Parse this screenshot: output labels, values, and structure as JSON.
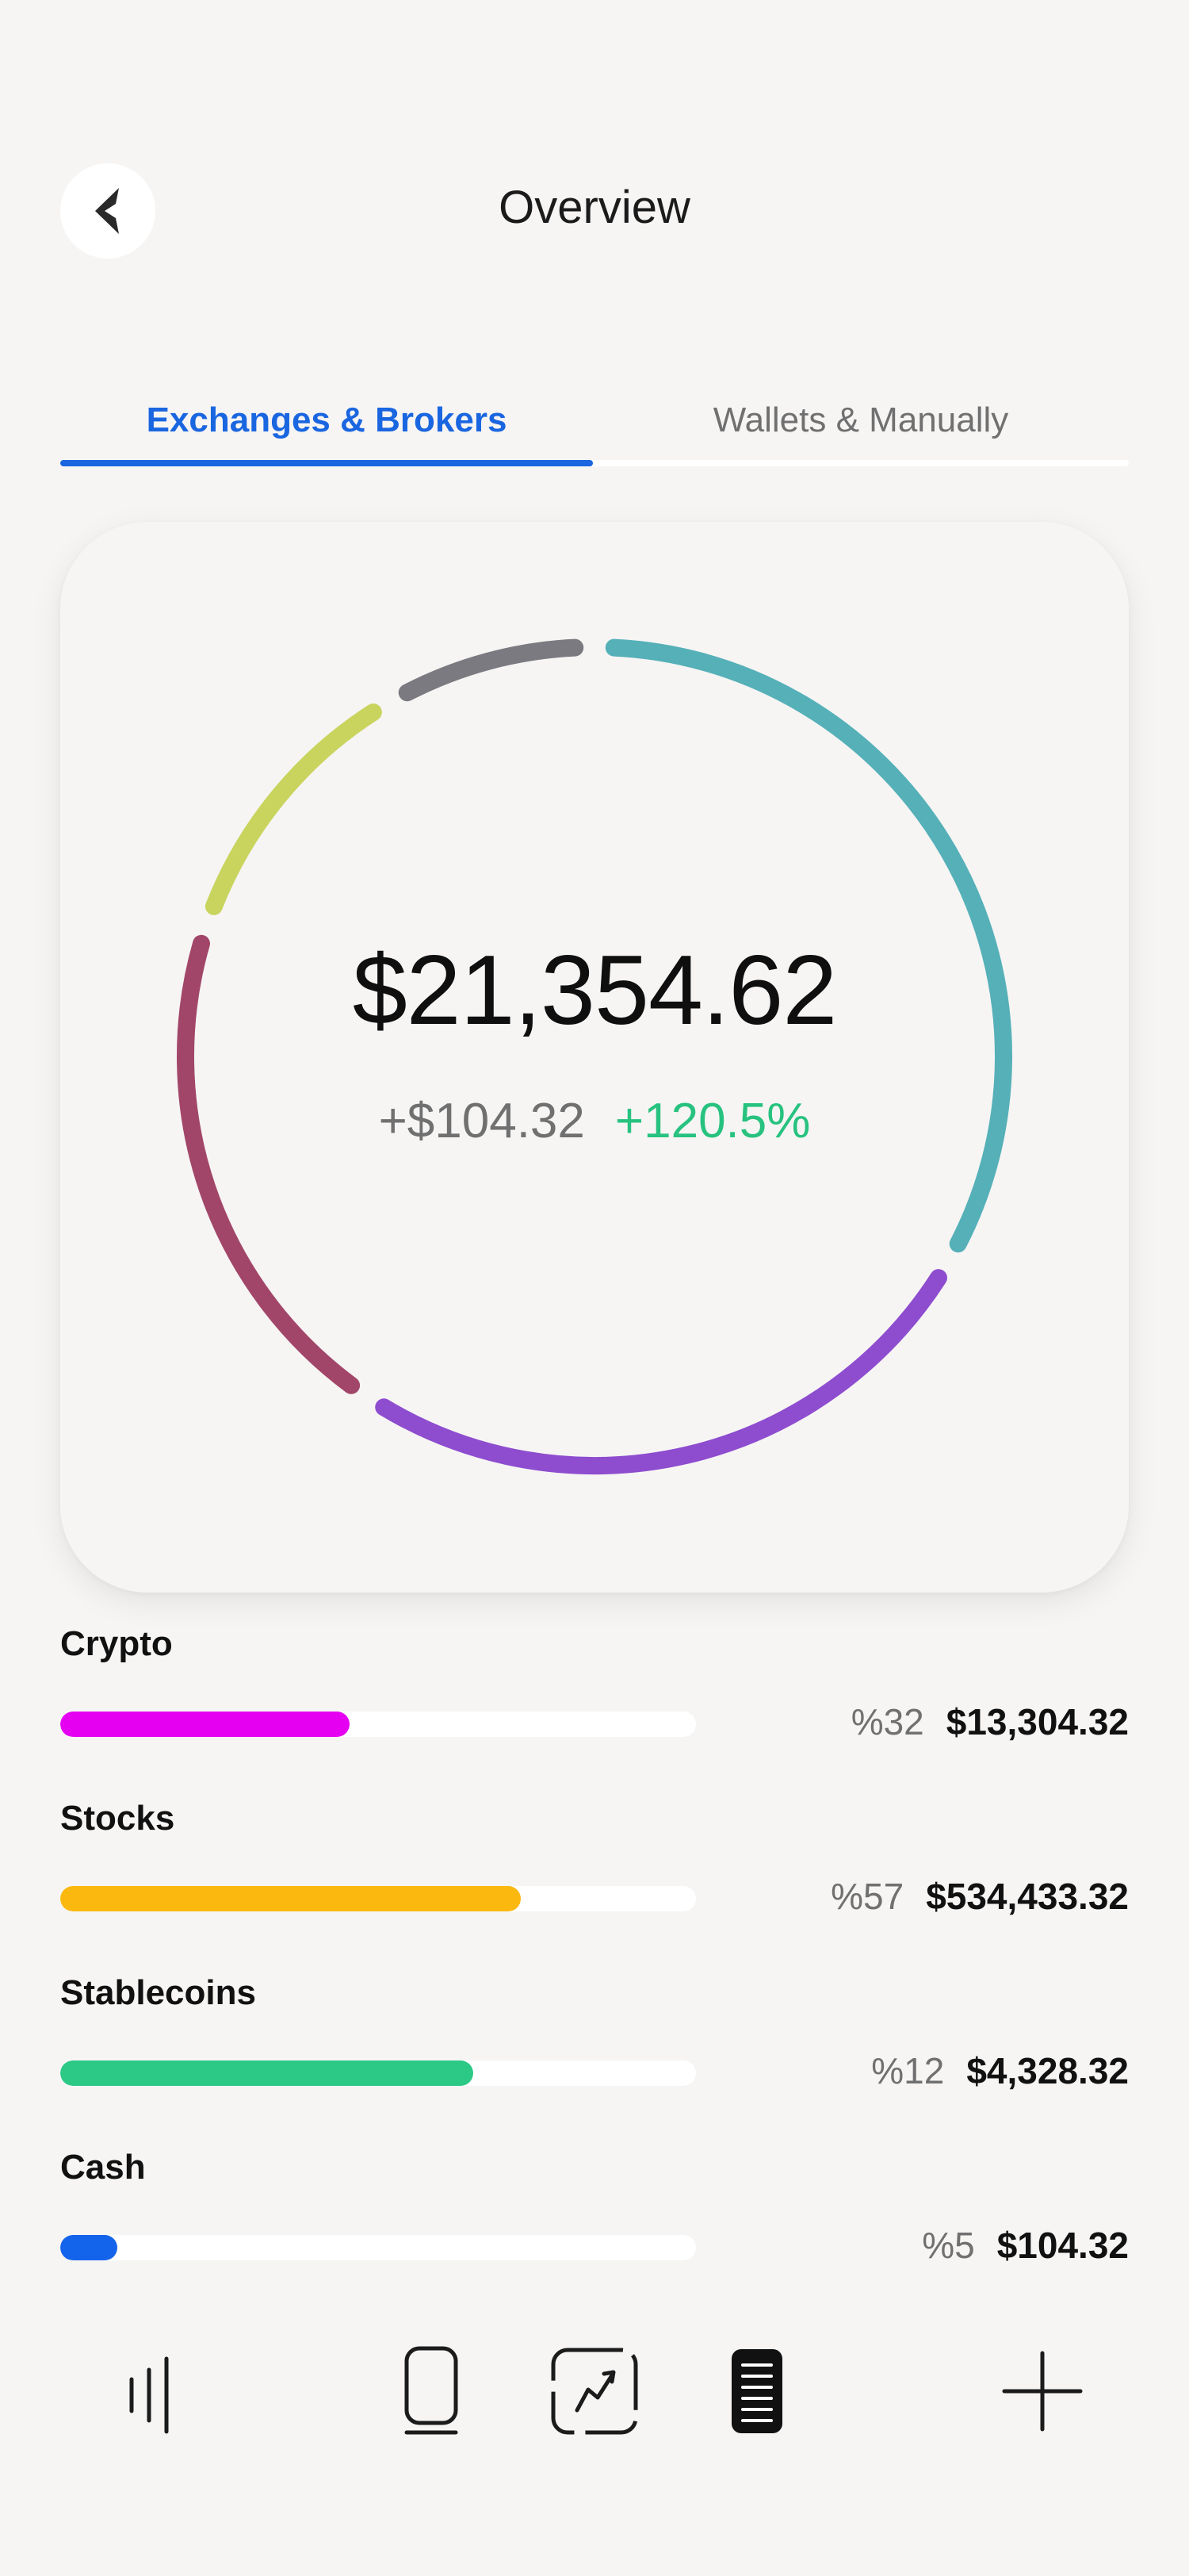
{
  "header": {
    "title": "Overview"
  },
  "tabs": [
    {
      "label": "Exchanges & Brokers",
      "active": true
    },
    {
      "label": "Wallets & Manually",
      "active": false
    }
  ],
  "summary": {
    "total": "$21,354.62",
    "change_abs": "+$104.32",
    "change_pct": "+120.5%"
  },
  "chart_data": {
    "type": "pie",
    "style": "donut-ring",
    "segments": [
      {
        "value": 32,
        "color": "#55b0b8"
      },
      {
        "value": 25,
        "color": "#8e4ccf"
      },
      {
        "value": 20,
        "color": "#a24669"
      },
      {
        "value": 11,
        "color": "#c9d45e"
      },
      {
        "value": 8,
        "color": "#7a7a80"
      }
    ]
  },
  "assets": [
    {
      "name": "Crypto",
      "percent": "%32",
      "amount": "$13,304.32",
      "fill": 0.455,
      "color": "#e500f2"
    },
    {
      "name": "Stocks",
      "percent": "%57",
      "amount": "$534,433.32",
      "fill": 0.725,
      "color": "#fbb80f"
    },
    {
      "name": "Stablecoins",
      "percent": "%12",
      "amount": "$4,328.32",
      "fill": 0.65,
      "color": "#2bc985"
    },
    {
      "name": "Cash",
      "percent": "%5",
      "amount": "$104.32",
      "fill": 0.09,
      "color": "#1463eb"
    }
  ],
  "colors": {
    "accent": "#1a66e0",
    "positive": "#27c27f",
    "muted": "#707070"
  },
  "nav": {
    "items": [
      "bars-icon",
      "phone-icon",
      "chart-icon",
      "list-icon",
      "plus-icon"
    ],
    "active": "list-icon"
  }
}
